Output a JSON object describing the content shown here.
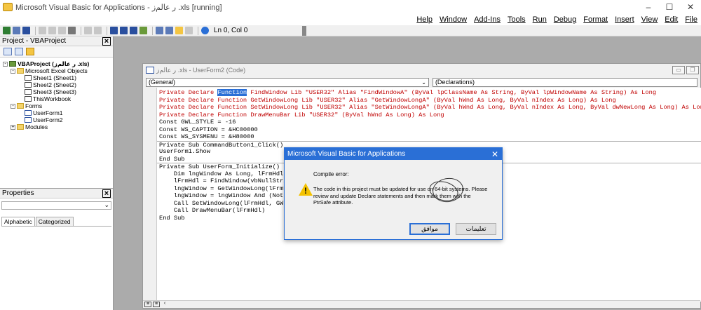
{
  "window": {
    "title": "Microsoft Visual Basic for Applications - ‎ز‏‎ر عالم .xls [running]",
    "controls": [
      "–",
      "☐",
      "✕"
    ]
  },
  "menu": [
    "Help",
    "Window",
    "Add-Ins",
    "Tools",
    "Run",
    "Debug",
    "Format",
    "Insert",
    "View",
    "Edit",
    "File"
  ],
  "toolbar": {
    "position_label": "Ln 0, Col 0"
  },
  "project_panel": {
    "title": "Project - VBAProject",
    "tree": [
      {
        "label": "VBAProject (‎ز‏‎ر عالم .xls)",
        "level": 0,
        "icon": "proj",
        "exp": "-"
      },
      {
        "label": "Microsoft Excel Objects",
        "level": 1,
        "icon": "folder",
        "exp": "-"
      },
      {
        "label": "Sheet1 (Sheet1)",
        "level": 2,
        "icon": "sheet",
        "exp": ""
      },
      {
        "label": "Sheet2 (Sheet2)",
        "level": 2,
        "icon": "sheet",
        "exp": ""
      },
      {
        "label": "Sheet3 (Sheet3)",
        "level": 2,
        "icon": "sheet",
        "exp": ""
      },
      {
        "label": "ThisWorkbook",
        "level": 2,
        "icon": "sheet",
        "exp": ""
      },
      {
        "label": "Forms",
        "level": 1,
        "icon": "folder",
        "exp": "-"
      },
      {
        "label": "UserForm1",
        "level": 2,
        "icon": "form",
        "exp": ""
      },
      {
        "label": "UserForm2",
        "level": 2,
        "icon": "form",
        "exp": ""
      },
      {
        "label": "Modules",
        "level": 1,
        "icon": "folder",
        "exp": "+"
      }
    ]
  },
  "properties_panel": {
    "title": "Properties",
    "tabs": [
      "Alphabetic",
      "Categorized"
    ]
  },
  "code_window": {
    "title": "‎ز‏‎ر عالم .xls - UserForm2 (Code)",
    "object_combo": "(General)",
    "proc_combo": "(Declarations)",
    "lines": [
      {
        "text": "Private Declare ",
        "sel": "Function",
        "rest": " FindWindow Lib \"USER32\" Alias \"FindWindowA\" (ByVal lpClassName As String, ByVal lpWindowName As String) As Long",
        "red": true
      },
      {
        "text": "Private Declare Function GetWindowLong Lib \"USER32\" Alias \"GetWindowLongA\" (ByVal hWnd As Long, ByVal nIndex As Long) As Long",
        "red": true
      },
      {
        "text": "Private Declare Function SetWindowLong Lib \"USER32\" Alias \"SetWindowLongA\" (ByVal hWnd As Long, ByVal nIndex As Long, ByVal dwNewLong As Long) As Long",
        "red": true
      },
      {
        "text": "Private Declare Function DrawMenuBar Lib \"USER32\" (ByVal hWnd As Long) As Long",
        "red": true
      },
      {
        "text": "Const GWL_STYLE = -16"
      },
      {
        "text": "Const WS_CAPTION = &HC00000"
      },
      {
        "text": "Const WS_SYSMENU = &H80000"
      },
      {
        "text": "Private Sub CommandButton1_Click()",
        "sep": true
      },
      {
        "text": "UserForm1.Show"
      },
      {
        "text": "End Sub"
      },
      {
        "text": "Private Sub UserForm_Initialize()",
        "sep": true
      },
      {
        "text": "    Dim lngWindow As Long, lFrmHdl"
      },
      {
        "text": "    lFrmHdl = FindWindow(vbNullStri"
      },
      {
        "text": "    lngWindow = GetWindowLong(lFrmH"
      },
      {
        "text": "    lngWindow = lngWindow And (Not"
      },
      {
        "text": "    Call SetWindowLong(lFrmHdl, GWL"
      },
      {
        "text": "    Call DrawMenuBar(lFrmHdl)"
      },
      {
        "text": "End Sub"
      }
    ]
  },
  "dialog": {
    "title": "Microsoft Visual Basic for Applications",
    "heading": "Compile error:",
    "message": "The code in this project must be updated for use on 64-bit systems. Please review and update Declare statements and then mark them with the PtrSafe attribute.",
    "ok_label": "موافق",
    "help_label": "تعليمات"
  }
}
